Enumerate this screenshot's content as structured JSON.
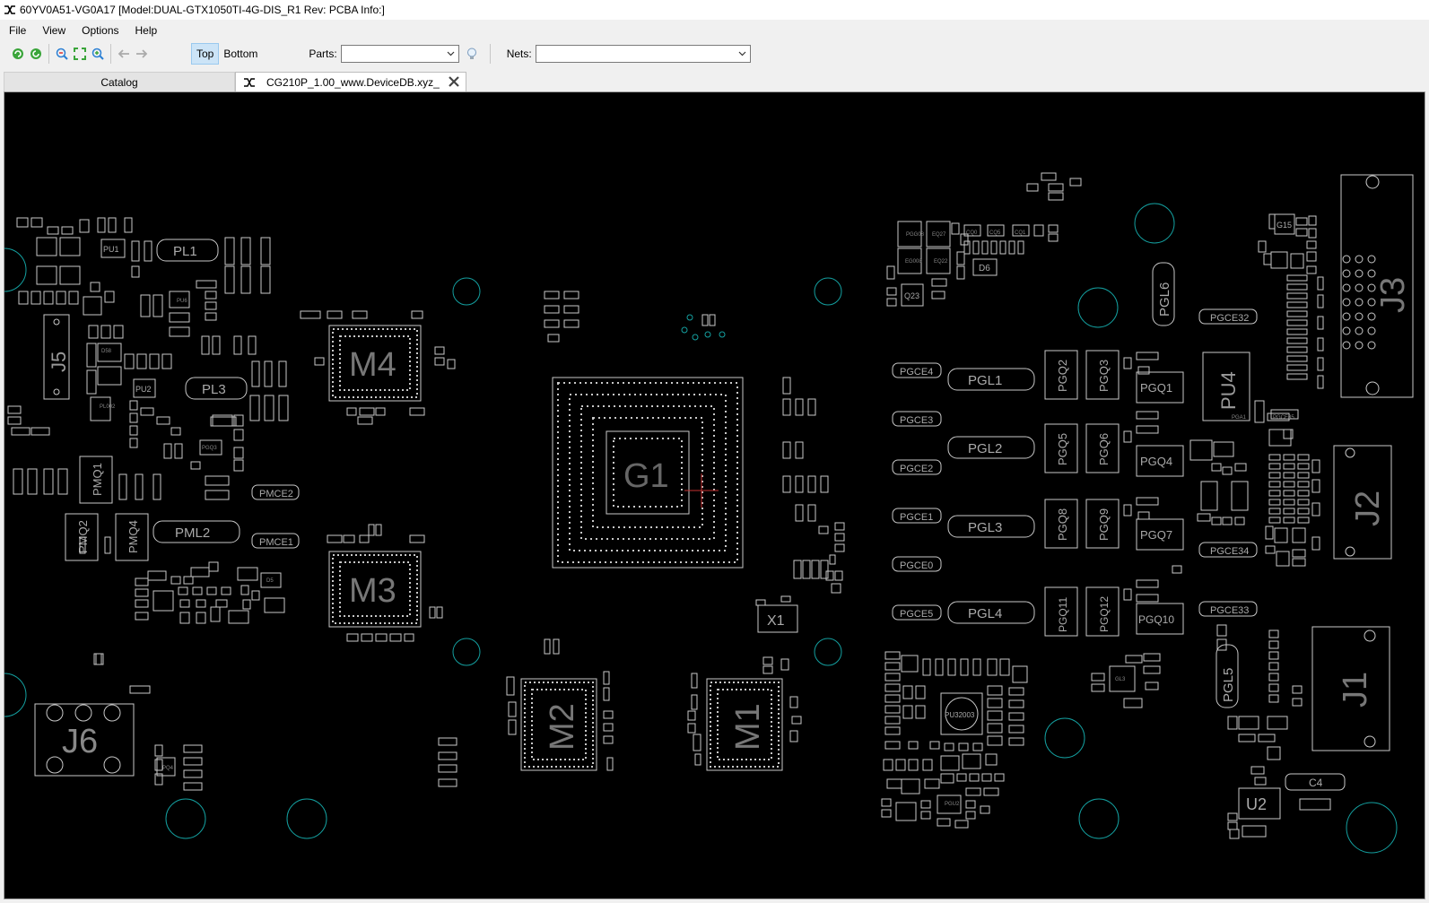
{
  "window": {
    "title": "60YV0A51-VG0A17 [Model:DUAL-GTX1050TI-4G-DIS_R1 Rev: PCBA Info:]"
  },
  "menu": {
    "file": "File",
    "view": "View",
    "options": "Options",
    "help": "Help"
  },
  "toolbar": {
    "top_label": "Top",
    "bottom_label": "Bottom",
    "parts_label": "Parts:",
    "parts_value": "",
    "nets_label": "Nets:",
    "nets_value": ""
  },
  "tabs": {
    "catalog": "Catalog",
    "document": "CG210P_1.00_www.DeviceDB.xyz_"
  },
  "board": {
    "chips": {
      "g1": "G1",
      "m1": "M1",
      "m2": "M2",
      "m3": "M3",
      "m4": "M4",
      "pu4": "PU4",
      "pu32003": "PU32003",
      "u2": "U2"
    },
    "connectors": {
      "j1": "J1",
      "j2": "J2",
      "j3": "J3",
      "j5": "J5",
      "j6": "J6"
    },
    "inductors": {
      "pl1": "PL1",
      "pl3": "PL3",
      "pml2": "PML2",
      "pgl1": "PGL1",
      "pgl2": "PGL2",
      "pgl3": "PGL3",
      "pgl4": "PGL4",
      "pgl5": "PGL5",
      "pgl6": "PGL6"
    },
    "mosfets": {
      "pgq1": "PGQ1",
      "pgq2": "PGQ2",
      "pgq3": "PGQ3",
      "pgq4": "PGQ4",
      "pgq5": "PGQ5",
      "pgq6": "PGQ6",
      "pgq7": "PGQ7",
      "pgq8": "PGQ8",
      "pgq9": "PGQ9",
      "pgq10": "PGQ10",
      "pgq11": "PGQ11",
      "pgq12": "PGQ12",
      "pmq1": "PMQ1",
      "pmq2": "PMQ2",
      "pmq4": "PMQ4"
    },
    "caps": {
      "pgce4": "PGCE4",
      "pgce3": "PGCE3",
      "pgce2": "PGCE2",
      "pgce1": "PGCE1",
      "pgce0": "PGCE0",
      "pgce5": "PGCE5",
      "pgce32": "PGCE32",
      "pgce34": "PGCE34",
      "pgce33": "PGCE33",
      "pmce2": "PMCE2",
      "pmce1": "PMCE1",
      "c4": "C4"
    },
    "misc": {
      "x1": "X1",
      "d6": "D6",
      "q23": "Q23",
      "pu1": "PU1",
      "pu2": "PU2",
      "g15": "G15"
    }
  },
  "colors": {
    "canvas_bg": "#000000",
    "silkscreen": "#c8c8c8",
    "mounting_hole": "#14a0a0",
    "cursor": "#c83232"
  }
}
